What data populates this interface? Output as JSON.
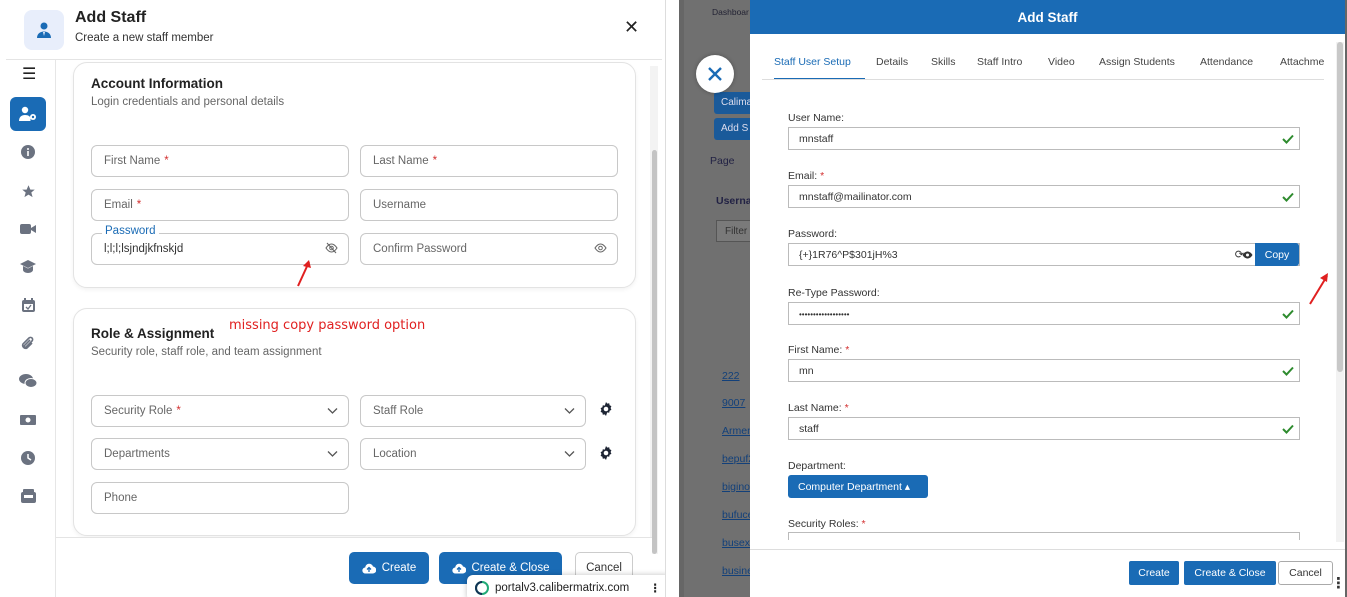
{
  "left": {
    "header": {
      "title": "Add Staff",
      "subtitle": "Create a new staff member"
    },
    "account": {
      "title": "Account Information",
      "subtitle": "Login credentials and personal details",
      "first_name": "First Name",
      "last_name": "Last Name",
      "email": "Email",
      "username": "Username",
      "password_label": "Password",
      "password_value": "l;l;l;lsjndjkfnskjd",
      "confirm_password": "Confirm Password",
      "required_mark": "*"
    },
    "role": {
      "title": "Role & Assignment",
      "subtitle": "Security role, staff role, and team assignment",
      "security_role": "Security Role",
      "staff_role": "Staff Role",
      "departments": "Departments",
      "location": "Location",
      "phone": "Phone"
    },
    "annotation": "missing copy password option",
    "footer": {
      "create": "Create",
      "create_close": "Create & Close",
      "cancel": "Cancel"
    },
    "url": "portalv3.calibermatrix.com",
    "rail_icons": [
      "user-gear-icon",
      "info-icon",
      "star-icon",
      "video-icon",
      "graduation-cap-icon",
      "calendar-icon",
      "paperclip-icon",
      "chat-icon",
      "money-icon",
      "clock-icon",
      "inbox-icon"
    ]
  },
  "right": {
    "background": {
      "dashboard": "Dashboar",
      "btn1": "Calima",
      "btn2": "Add S",
      "page": "Page",
      "username_col": "Userna",
      "filter": "Filter",
      "links": [
        "222",
        "9007",
        "Armen",
        "bepuf2",
        "bigino",
        "bufuce",
        "busexe",
        "busine"
      ]
    },
    "modal": {
      "title": "Add Staff",
      "tabs": [
        "Staff User Setup",
        "Details",
        "Skills",
        "Staff Intro",
        "Video",
        "Assign Students",
        "Attendance",
        "Attachme"
      ],
      "active_tab": "Staff User Setup",
      "user_name_label": "User Name:",
      "user_name": "mnstaff",
      "email_label": "Email:",
      "email": "mnstaff@mailinator.com",
      "password_label": "Password:",
      "password": "{+}1R76^P$301jH%3",
      "copy": "Copy",
      "retype_label": "Re-Type Password:",
      "retype": "••••••••••••••••••",
      "first_name_label": "First Name:",
      "first_name": "mn",
      "last_name_label": "Last Name:",
      "last_name": "staff",
      "department_label": "Department:",
      "department": "Computer Department ▴",
      "security_roles_label": "Security Roles:",
      "required_mark": "*",
      "footer": {
        "create": "Create",
        "create_close": "Create & Close",
        "cancel": "Cancel"
      }
    }
  },
  "colors": {
    "accent": "#1a6bb5",
    "required": "#d32f2f",
    "annotation": "#e02020",
    "ok": "#2e8b2e"
  }
}
